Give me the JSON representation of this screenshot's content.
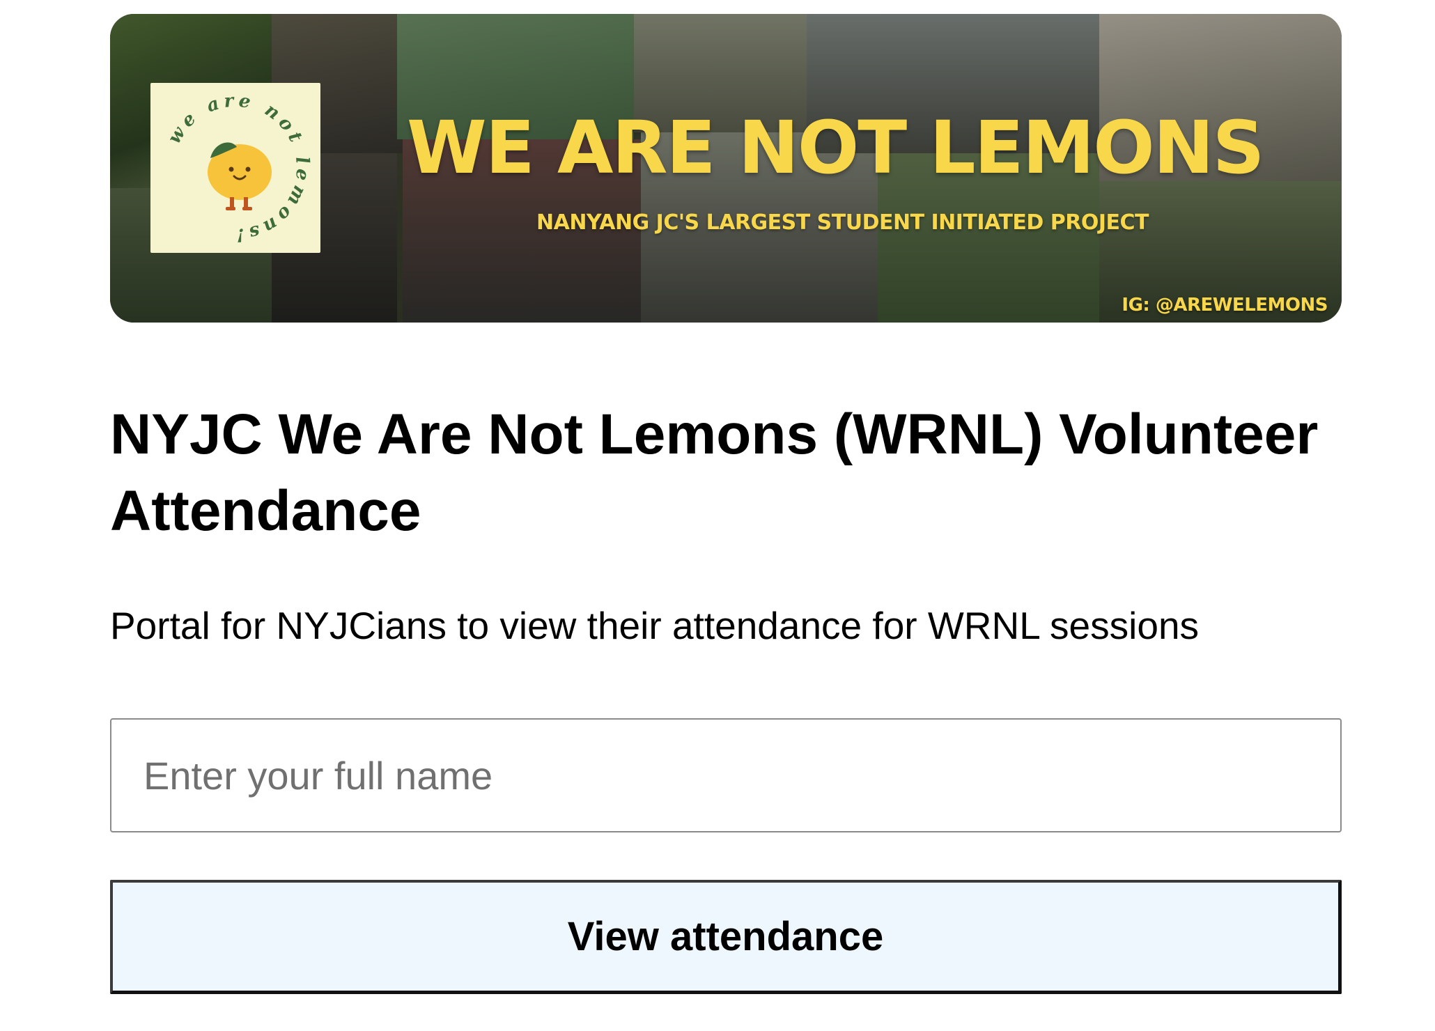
{
  "banner": {
    "headline": "WE ARE NOT LEMONS",
    "subline": "NANYANG JC'S LARGEST STUDENT INITIATED PROJECT",
    "instagram": "IG: @AREWELEMONS",
    "logo_text": "we are not lemons!",
    "headline_color": "#f8d84a"
  },
  "page": {
    "title": "NYJC We Are Not Lemons (WRNL) Volunteer Attendance",
    "description": "Portal for NYJCians to view their attendance for WRNL sessions"
  },
  "form": {
    "name_input": {
      "placeholder": "Enter your full name",
      "value": ""
    },
    "submit_label": "View attendance",
    "submit_bg": "#eef6fe"
  }
}
